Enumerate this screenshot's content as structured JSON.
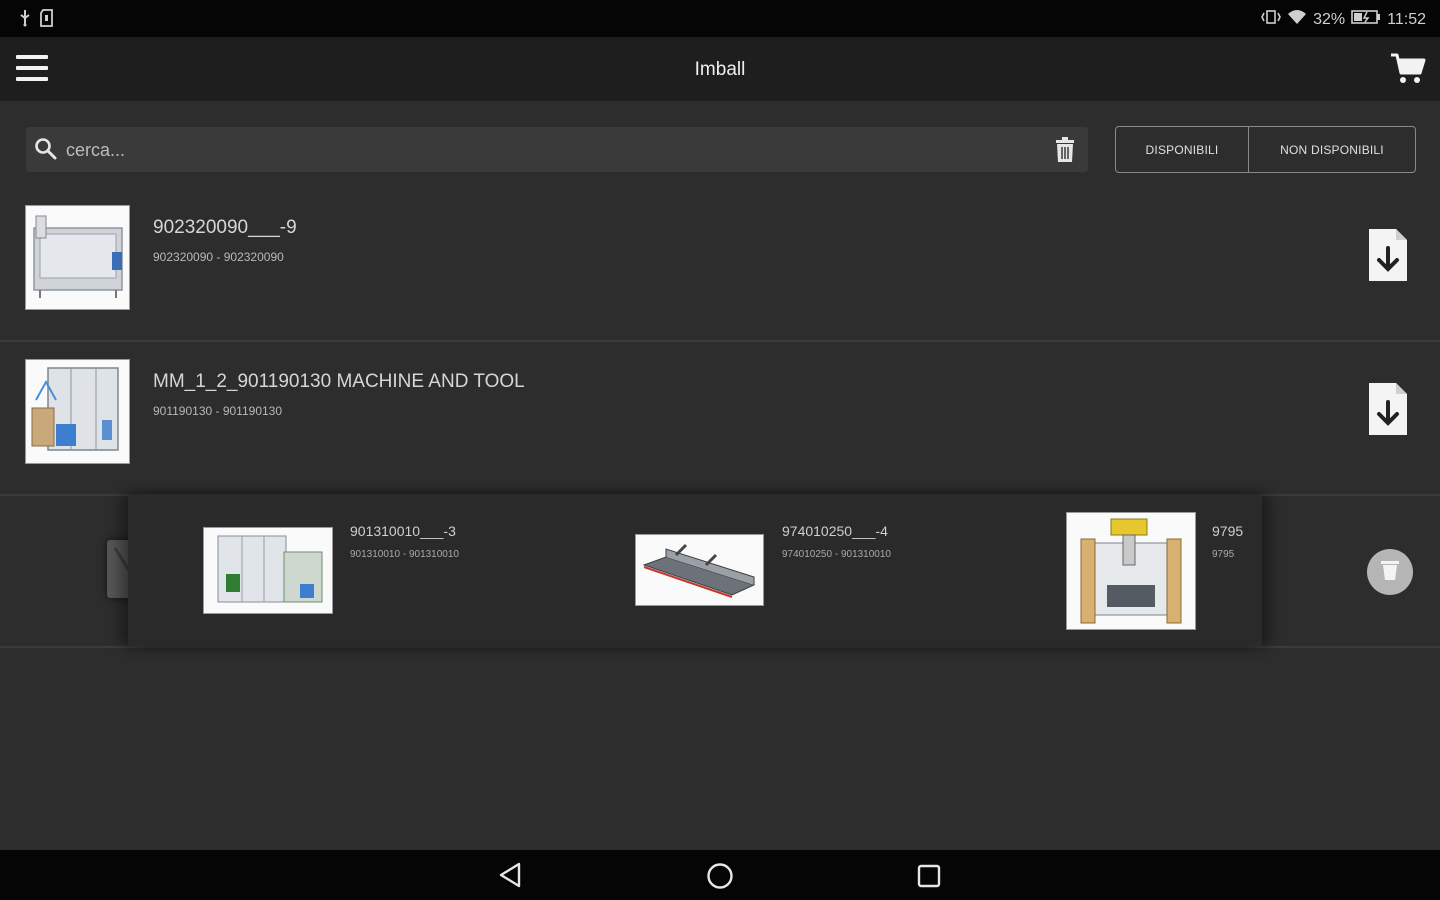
{
  "status_bar": {
    "battery_percent": "32%",
    "time": "11:52",
    "icons": [
      "usb-icon",
      "sd-card-icon",
      "vibrate-icon",
      "wifi-icon",
      "battery-icon"
    ]
  },
  "app_bar": {
    "title": "Imball",
    "icons": [
      "menu-icon",
      "cart-icon"
    ]
  },
  "search": {
    "placeholder": "cerca..."
  },
  "filters": {
    "available": "DISPONIBILI",
    "not_available": "NON DISPONIBILI"
  },
  "items": [
    {
      "title": "902320090___-9",
      "subtitle": "902320090 - 902320090"
    },
    {
      "title": "MM_1_2_901190130 MACHINE AND TOOL",
      "subtitle": "901190130 - 901190130"
    }
  ],
  "sub_items": [
    {
      "title": "901310010___-3",
      "subtitle": "901310010 - 901310010"
    },
    {
      "title": "974010250___-4",
      "subtitle": "974010250 - 901310010"
    },
    {
      "title": "9795",
      "subtitle": "9795"
    }
  ],
  "colors": {
    "background": "#2d2d2d",
    "app_bar": "#1e1e1e",
    "status_bar": "#050505",
    "search_box": "#3a3a3a"
  }
}
